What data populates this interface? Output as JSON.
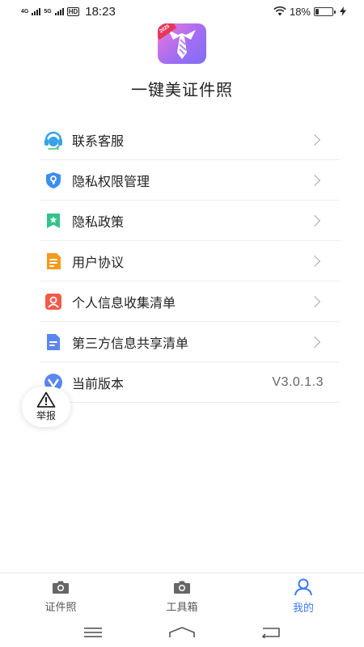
{
  "status_bar": {
    "net_top": "4G",
    "net_bottom": "5G",
    "hd": "HD",
    "time": "18:23",
    "battery_pct": "18%",
    "battery_level": 0.18
  },
  "app": {
    "name": "一键美证件照",
    "badge_text": "2025"
  },
  "menu": {
    "items": [
      {
        "label": "联系客服",
        "icon": "customer-service-icon"
      },
      {
        "label": "隐私权限管理",
        "icon": "privacy-shield-icon"
      },
      {
        "label": "隐私政策",
        "icon": "policy-bookmark-icon"
      },
      {
        "label": "用户协议",
        "icon": "document-icon"
      },
      {
        "label": "个人信息收集清单",
        "icon": "person-card-icon"
      },
      {
        "label": "第三方信息共享清单",
        "icon": "share-doc-icon"
      },
      {
        "label": "当前版本",
        "icon": "version-icon",
        "value": "V3.0.1.3"
      }
    ]
  },
  "report": {
    "label": "举报",
    "icon": "warning-icon"
  },
  "tabbar": {
    "tabs": [
      {
        "label": "证件照",
        "icon": "camera-icon",
        "active": false
      },
      {
        "label": "工具箱",
        "icon": "camera-icon",
        "active": false
      },
      {
        "label": "我的",
        "icon": "person-icon",
        "active": true
      }
    ]
  },
  "colors": {
    "accent": "#3d7bf2",
    "text": "#222222",
    "muted": "#666666",
    "divider": "#ececec"
  }
}
